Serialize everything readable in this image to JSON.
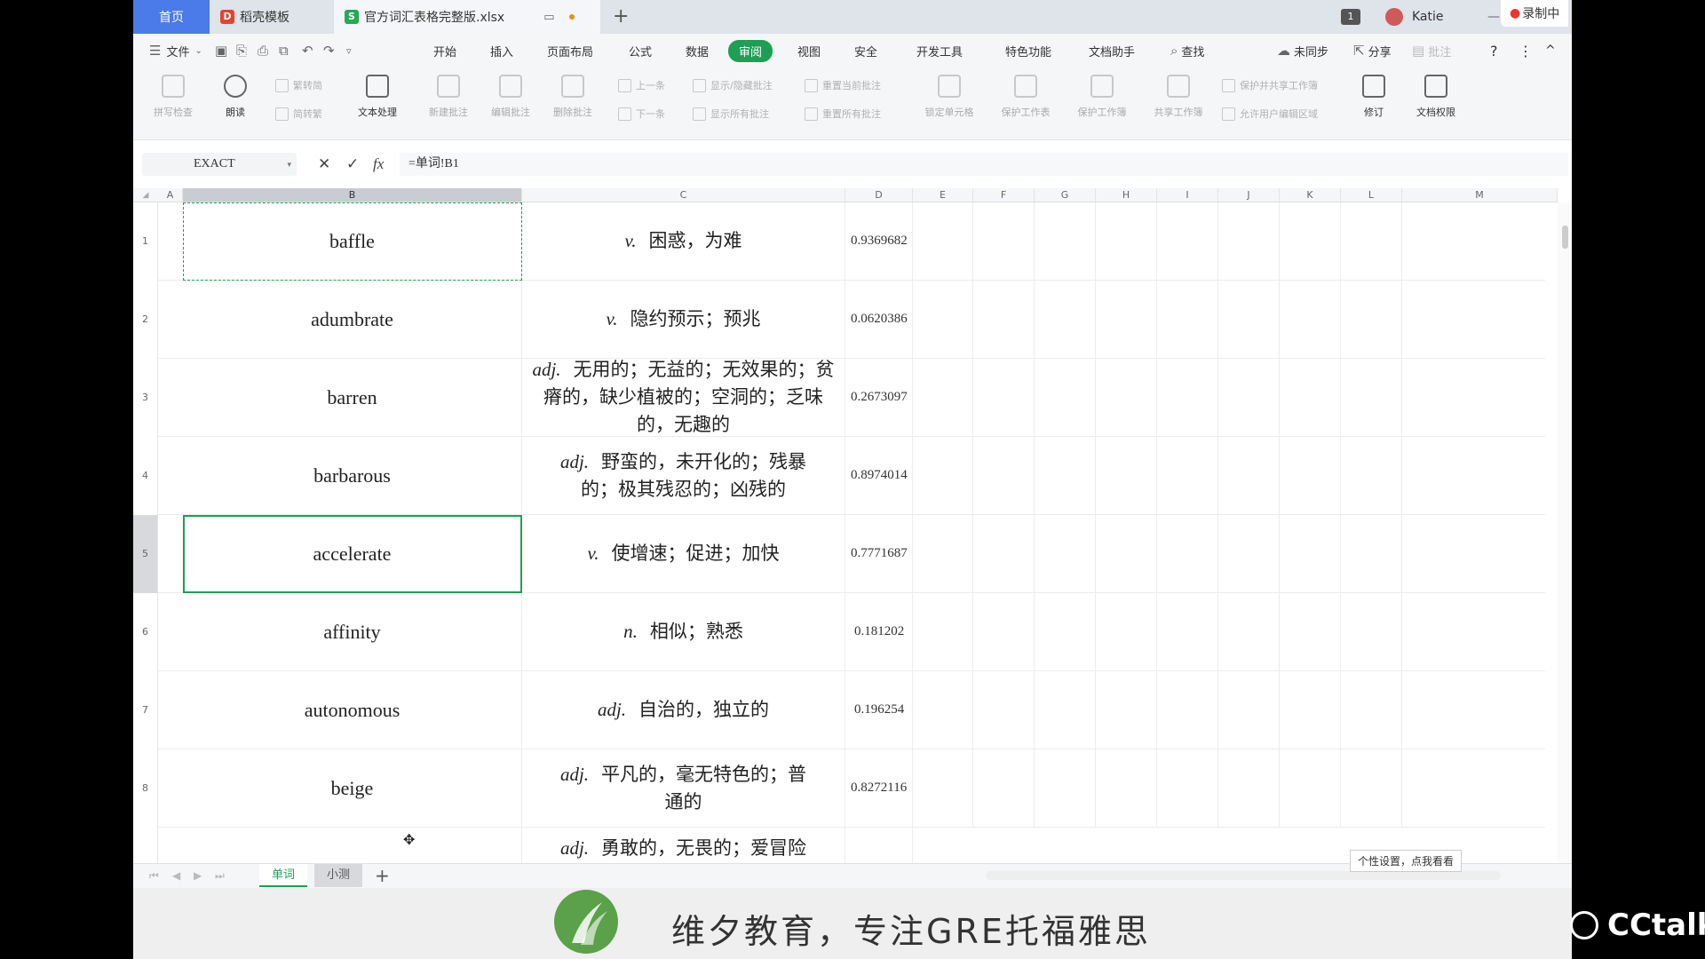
{
  "tabs": {
    "home": "首页",
    "template": "稻壳模板",
    "file": "官方词汇表格完整版.xlsx",
    "add": "+"
  },
  "titlebar": {
    "badge": "1",
    "user": "Katie",
    "minimize": "—",
    "recording": "录制中"
  },
  "menu": {
    "file": "文件",
    "items": [
      "开始",
      "插入",
      "页面布局",
      "公式",
      "数据",
      "审阅",
      "视图",
      "安全",
      "开发工具",
      "特色功能",
      "文档助手"
    ],
    "active": "审阅",
    "search": "查找",
    "sync": "未同步",
    "share": "分享",
    "comment": "批注",
    "help": "?",
    "more": "⋮",
    "collapse": "^"
  },
  "ribbon": {
    "spell": "拼写检查",
    "read": "朗读",
    "trad": "繁转简",
    "simp": "简转繁",
    "text": "文本处理",
    "newc": "新建批注",
    "editc": "编辑批注",
    "delc": "删除批注",
    "prev": "上一条",
    "next": "下一条",
    "showhide": "显示/隐藏批注",
    "showall": "显示所有批注",
    "resetcur": "重置当前批注",
    "resetall": "重置所有批注",
    "lockcell": "锁定单元格",
    "protsheet": "保护工作表",
    "protbook": "保护工作簿",
    "sharebook": "共享工作簿",
    "protshare": "保护并共享工作簿",
    "allowedit": "允许用户编辑区域",
    "revise": "修订",
    "docperm": "文档权限"
  },
  "formula": {
    "namebox": "EXACT",
    "cancel": "✕",
    "confirm": "✓",
    "fx": "fx",
    "value": "=单词!B1"
  },
  "columns": [
    "A",
    "B",
    "C",
    "D",
    "E",
    "F",
    "G",
    "H",
    "I",
    "J",
    "K",
    "L",
    "M"
  ],
  "rows": [
    {
      "num": "1",
      "word": "baffle",
      "pos": "v.",
      "meaning": "困惑，为难",
      "val": "0.9369682"
    },
    {
      "num": "2",
      "word": "adumbrate",
      "pos": "v.",
      "meaning": "隐约预示；预兆",
      "val": "0.0620386"
    },
    {
      "num": "3",
      "word": "barren",
      "pos": "adj.",
      "meaning": "无用的；无益的；无效果的；贫瘠的，缺少植被的；空洞的；乏味的，无趣的",
      "val": "0.2673097"
    },
    {
      "num": "4",
      "word": "barbarous",
      "pos": "adj.",
      "meaning": "野蛮的，未开化的；残暴的；极其残忍的；凶残的",
      "val": "0.8974014"
    },
    {
      "num": "5",
      "word": "accelerate",
      "pos": "v.",
      "meaning": "使增速；促进；加快",
      "val": "0.7771687"
    },
    {
      "num": "6",
      "word": "affinity",
      "pos": "n.",
      "meaning": "相似；熟悉",
      "val": "0.181202"
    },
    {
      "num": "7",
      "word": "autonomous",
      "pos": "adj.",
      "meaning": "自治的，独立的",
      "val": "0.196254"
    },
    {
      "num": "8",
      "word": "beige",
      "pos": "adj.",
      "meaning": "平凡的，毫无特色的；普通的",
      "val": "0.8272116"
    },
    {
      "num": "",
      "word": "",
      "pos": "adj.",
      "meaning": "勇敢的，无畏的；爱冒险",
      "val": ""
    }
  ],
  "sheets": {
    "active": "单词",
    "other": "小测",
    "add": "+",
    "tooltip": "个性设置，点我看看"
  },
  "banner": {
    "text": "维夕教育，专注GRE托福雅思",
    "watermark": "CCtalk"
  },
  "colors": {
    "accent": "#1f9e55",
    "home_tab": "#4a7be8"
  }
}
